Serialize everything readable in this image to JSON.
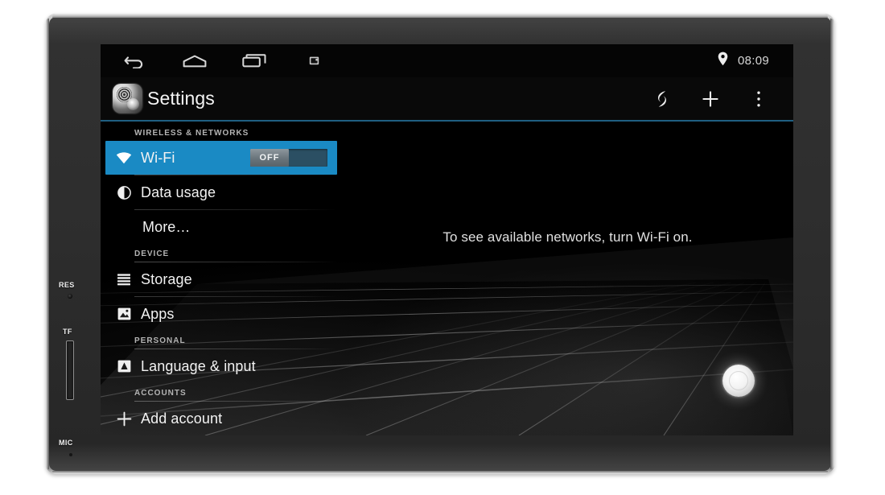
{
  "device": {
    "bezel_labels": [
      {
        "id": "res",
        "text": "RES"
      },
      {
        "id": "tf",
        "text": "TF"
      },
      {
        "id": "mic",
        "text": "MIC"
      }
    ]
  },
  "status_bar": {
    "nav": [
      {
        "name": "back-icon",
        "label": "Back"
      },
      {
        "name": "home-icon",
        "label": "Home"
      },
      {
        "name": "recents-icon",
        "label": "Recent apps"
      },
      {
        "name": "screenshot-icon",
        "label": "Screenshot"
      }
    ],
    "location_icon": "location-pin-icon",
    "time": "08:09"
  },
  "action_bar": {
    "app_icon": "settings-gear-icon",
    "title": "Settings",
    "icons": [
      {
        "name": "sync-icon",
        "label": "Sync"
      },
      {
        "name": "add-icon",
        "label": "Add"
      },
      {
        "name": "overflow-menu-icon",
        "label": "More options"
      }
    ],
    "accent_color": "#1f5f82"
  },
  "settings": {
    "accent_color": "#1a8ac4",
    "sections": [
      {
        "header": "WIRELESS & NETWORKS",
        "rows": [
          {
            "label": "Wi-Fi",
            "icon": "wifi-icon",
            "selected": true,
            "toggle": {
              "state_label": "OFF",
              "on": false
            }
          },
          {
            "label": "Data usage",
            "icon": "data-usage-icon",
            "selected": false
          },
          {
            "label": "More…",
            "icon": null,
            "selected": false,
            "indent": true
          }
        ]
      },
      {
        "header": "DEVICE",
        "rows": [
          {
            "label": "Storage",
            "icon": "storage-icon",
            "selected": false
          },
          {
            "label": "Apps",
            "icon": "apps-icon",
            "selected": false
          }
        ]
      },
      {
        "header": "PERSONAL",
        "rows": [
          {
            "label": "Language & input",
            "icon": "language-input-icon",
            "selected": false
          }
        ]
      },
      {
        "header": "ACCOUNTS",
        "rows": [
          {
            "label": "Add account",
            "icon": "plus-icon",
            "selected": false
          }
        ]
      }
    ]
  },
  "detail": {
    "empty_message": "To see available networks, turn Wi-Fi on."
  }
}
